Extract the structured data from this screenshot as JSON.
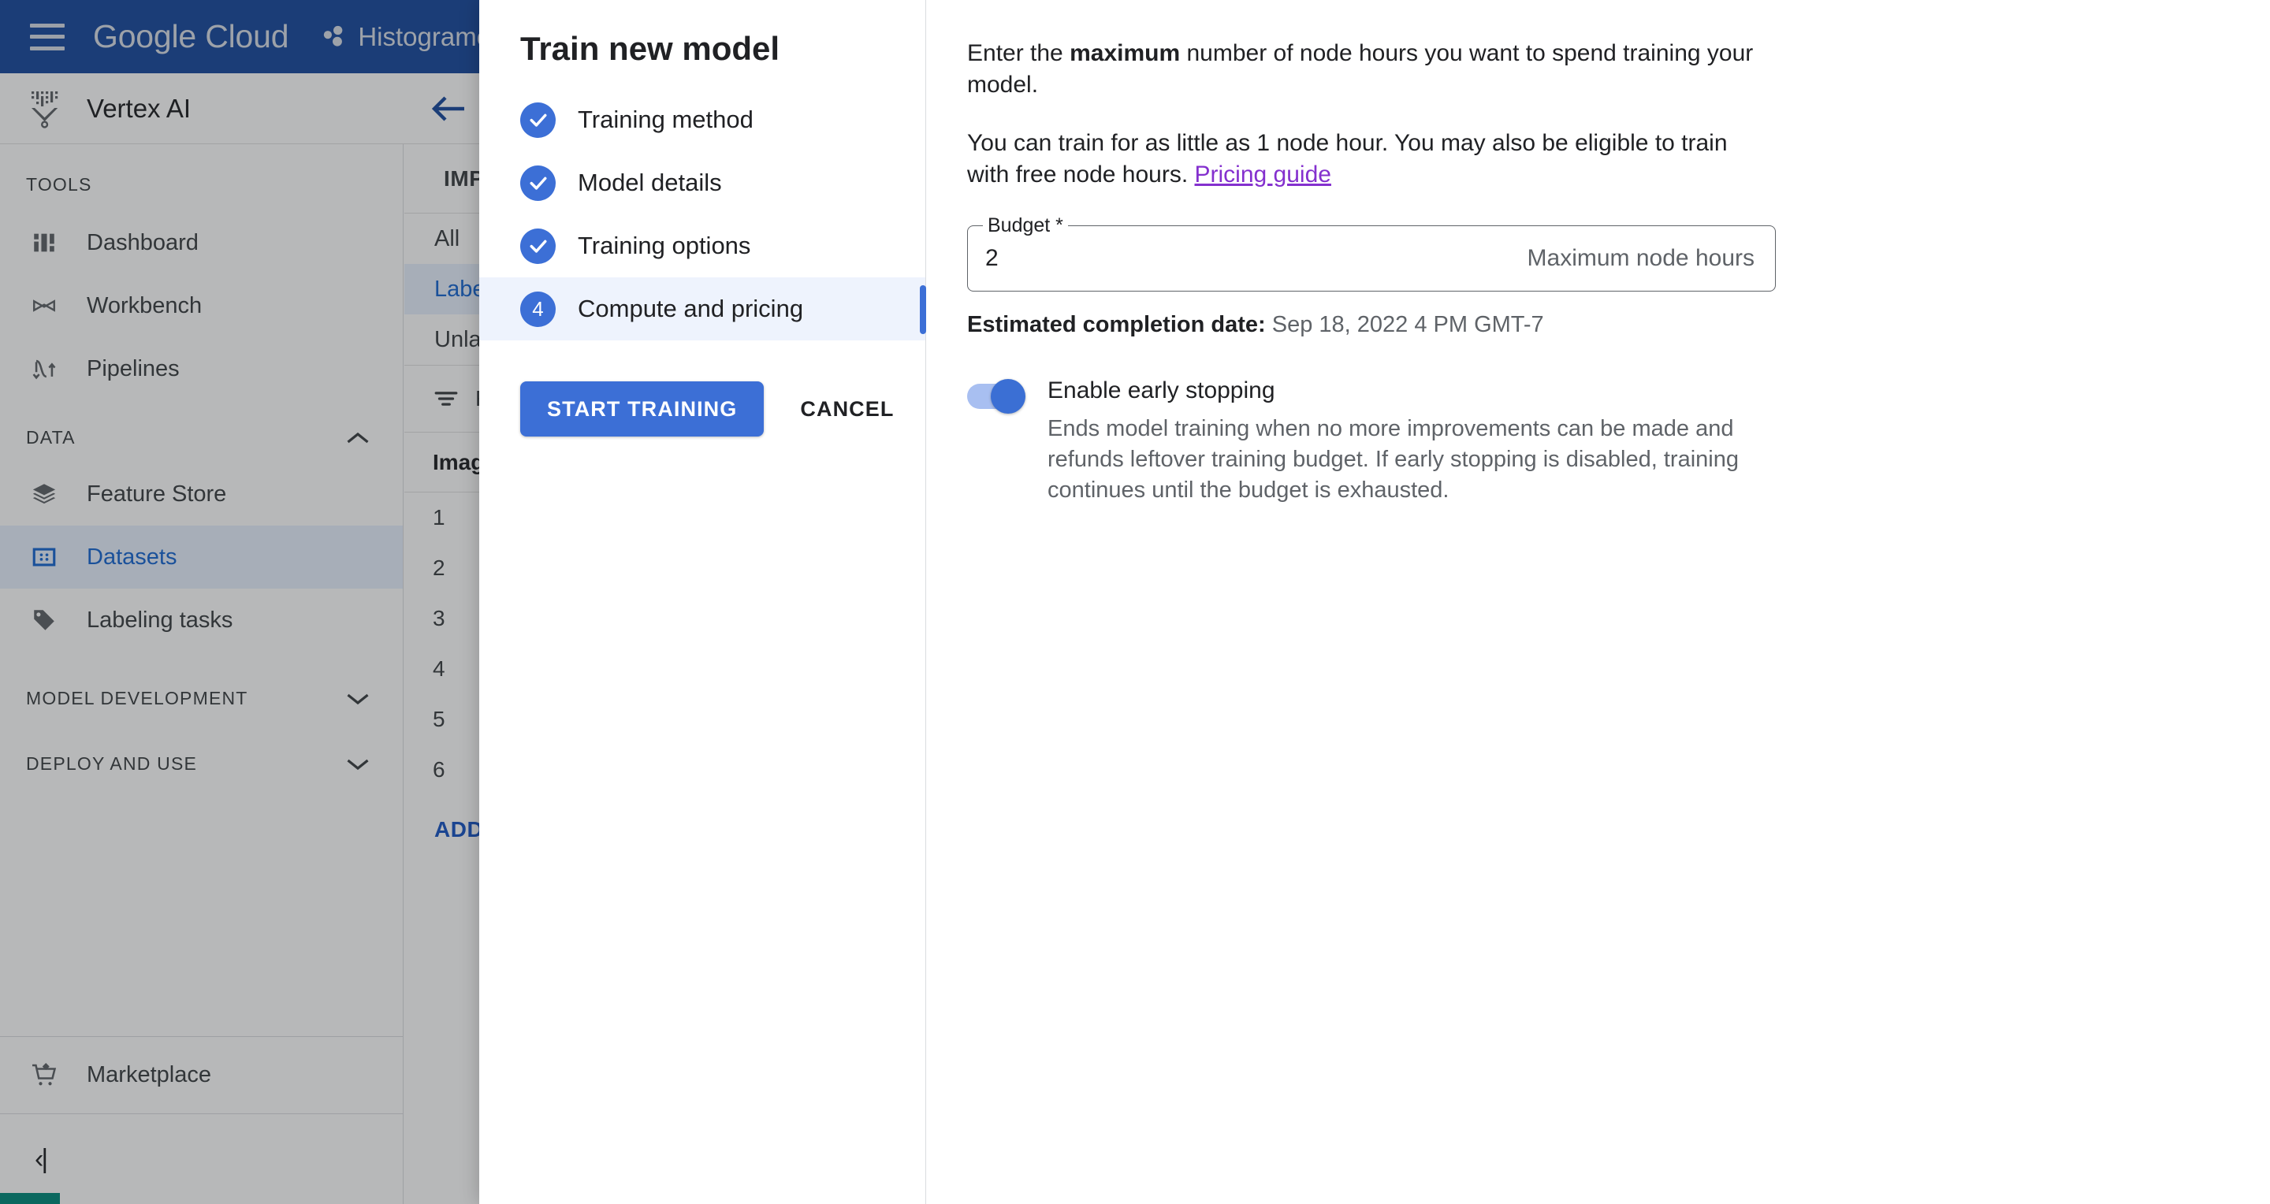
{
  "topbar": {
    "menu_icon": "hamburger-menu-icon",
    "brand": "Google Cloud",
    "project_icon": "project-dots-icon",
    "project_name": "Histogramo"
  },
  "product_header": {
    "icon": "vertex-ai-icon",
    "title": "Vertex AI"
  },
  "sidebar": {
    "sections": [
      {
        "label": "TOOLS",
        "collapsible": false,
        "items": [
          {
            "label": "Dashboard",
            "icon": "dashboard-icon",
            "active": false
          },
          {
            "label": "Workbench",
            "icon": "workbench-icon",
            "active": false
          },
          {
            "label": "Pipelines",
            "icon": "pipelines-icon",
            "active": false
          }
        ]
      },
      {
        "label": "DATA",
        "collapsible": true,
        "chevron": "chevron-up-icon",
        "items": [
          {
            "label": "Feature Store",
            "icon": "layers-icon",
            "active": false
          },
          {
            "label": "Datasets",
            "icon": "datasets-icon",
            "active": true
          },
          {
            "label": "Labeling tasks",
            "icon": "tag-icon",
            "active": false
          }
        ]
      },
      {
        "label": "MODEL DEVELOPMENT",
        "collapsible": true,
        "chevron": "chevron-down-icon",
        "items": []
      },
      {
        "label": "DEPLOY AND USE",
        "collapsible": true,
        "chevron": "chevron-down-icon",
        "items": []
      }
    ],
    "marketplace": {
      "label": "Marketplace",
      "icon": "marketplace-cart-icon"
    },
    "collapse": {
      "icon": "collapse-panel-icon",
      "glyph": "‹|"
    }
  },
  "background_page": {
    "back_icon": "back-arrow-icon",
    "import_label": "IMP",
    "tabs": [
      {
        "label": "All",
        "selected": false
      },
      {
        "label": "Label",
        "selected": true
      },
      {
        "label": "Unlab",
        "selected": false
      }
    ],
    "filter": {
      "icon": "filter-icon",
      "label": "F"
    },
    "column_header": "Image",
    "rows": [
      "1",
      "2",
      "3",
      "4",
      "5",
      "6"
    ],
    "add_link": "ADD"
  },
  "modal": {
    "title": "Train new model",
    "steps": [
      {
        "label": "Training method",
        "state": "complete",
        "bullet": "check-icon"
      },
      {
        "label": "Model details",
        "state": "complete",
        "bullet": "check-icon"
      },
      {
        "label": "Training options",
        "state": "complete",
        "bullet": "check-icon"
      },
      {
        "label": "Compute and pricing",
        "state": "current",
        "bullet": "4"
      }
    ],
    "actions": {
      "primary": "START TRAINING",
      "secondary": "CANCEL"
    },
    "panel": {
      "intro_prefix": "Enter the ",
      "intro_bold": "maximum",
      "intro_suffix": " number of node hours you want to spend training your model.",
      "detail_text": "You can train for as little as 1 node hour. You may also be eligible to train with free node hours. ",
      "detail_link": "Pricing guide",
      "budget_field": {
        "label": "Budget *",
        "value": "2",
        "suffix": "Maximum node hours"
      },
      "estimate_label": "Estimated completion date:",
      "estimate_value": " Sep 18, 2022 4 PM GMT-7",
      "early_stopping": {
        "enabled": true,
        "title": "Enable early stopping",
        "description": "Ends model training when no more improvements can be made and refunds leftover training budget. If early stopping is disabled, training continues until the budget is exhausted."
      }
    }
  },
  "colors": {
    "topbar_blue": "#1a4b9e",
    "accent_blue": "#3c6fd6",
    "active_nav_bg": "#e8f0fe",
    "active_nav_text": "#1967d2",
    "link_visited_purple": "#8430ce",
    "muted_text": "#5f6368",
    "teal_strip": "#00897b"
  }
}
